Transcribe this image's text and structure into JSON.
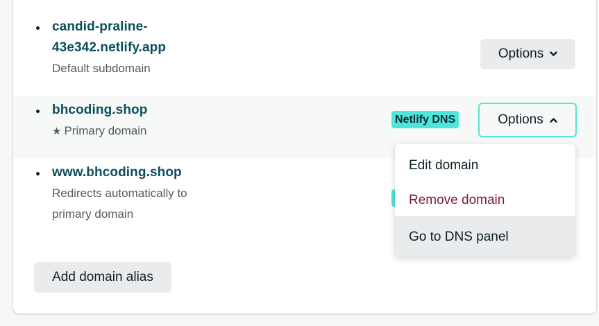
{
  "domains": [
    {
      "name_line1": "candid-praline-",
      "name_line2": "43e342.netlify.app",
      "subtitle": "Default subdomain",
      "options_label": "Options",
      "chevron": "chevron-down-icon"
    },
    {
      "name": "bhcoding.shop",
      "subtitle": "Primary domain",
      "star": "star-icon",
      "badge": "Netlify DNS",
      "options_label": "Options",
      "chevron": "chevron-up-icon"
    },
    {
      "name": "www.bhcoding.shop",
      "subtitle_line1": "Redirects automatically to",
      "subtitle_line2": "primary domain"
    }
  ],
  "options_menu": {
    "items": [
      {
        "label": "Edit domain"
      },
      {
        "label": "Remove domain"
      },
      {
        "label": "Go to DNS panel"
      }
    ]
  },
  "add_alias_label": "Add domain alias",
  "colors": {
    "domain_text": "#0b4f5c",
    "badge_bg": "#4ee6db",
    "focus_border": "#54e5d8",
    "danger_text": "#7b1a3b",
    "button_bg": "#e9ebed"
  }
}
